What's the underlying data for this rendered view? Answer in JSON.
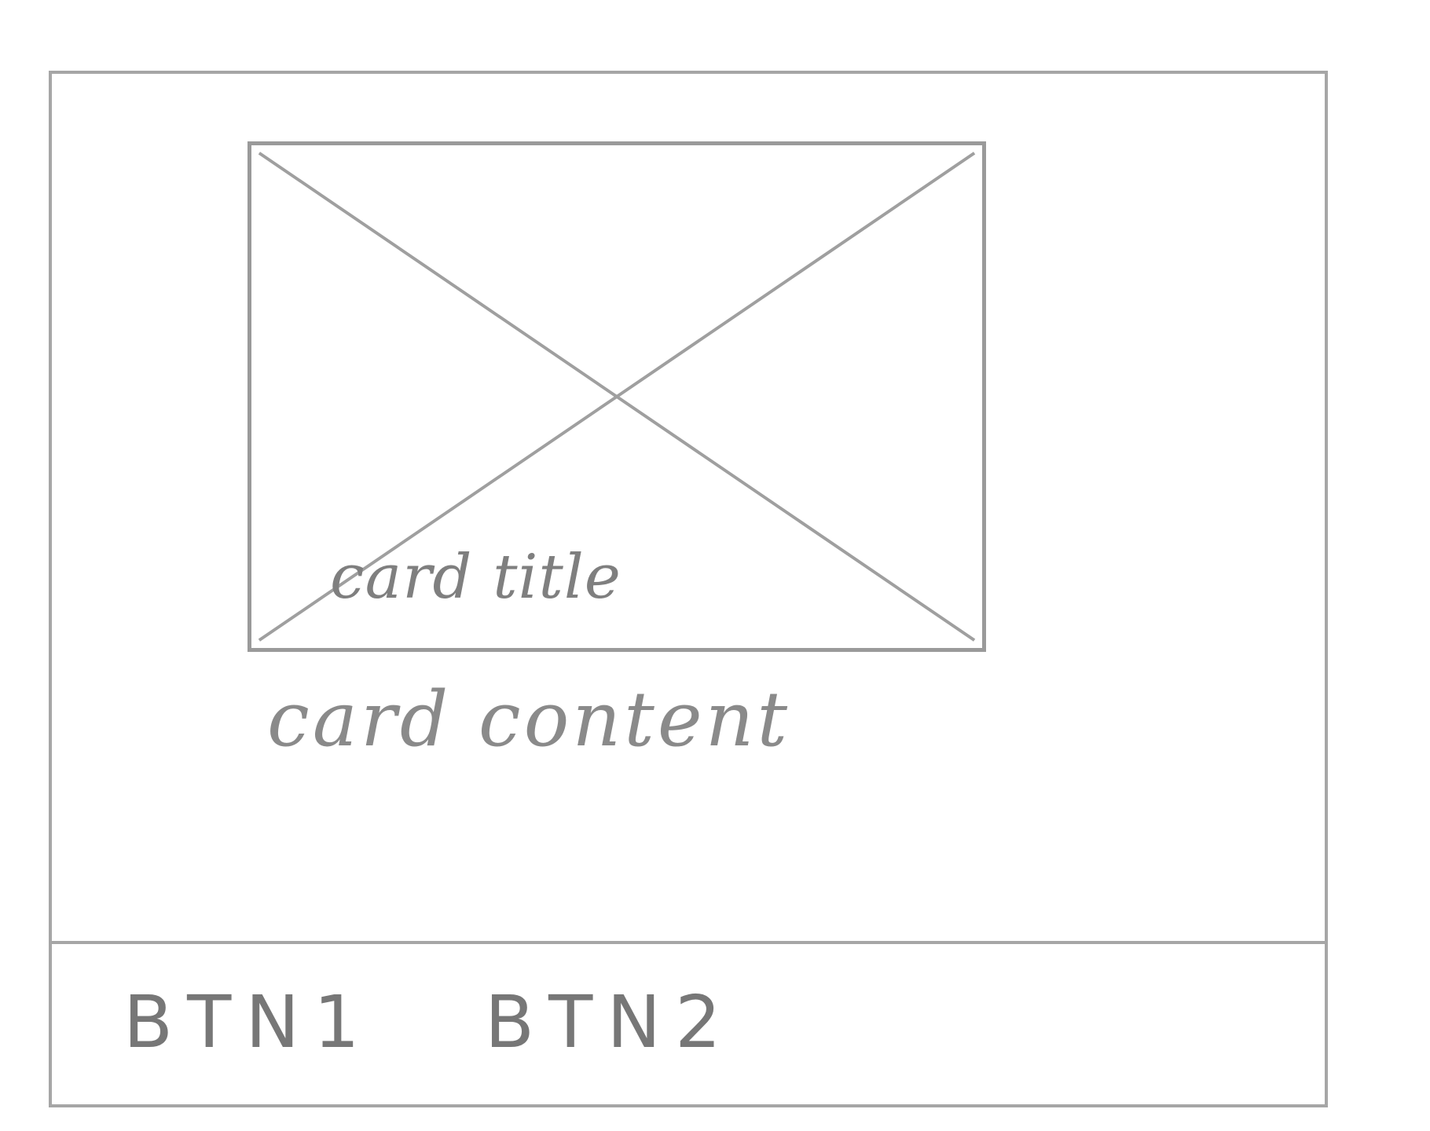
{
  "card": {
    "media_icon": "image-placeholder-icon",
    "title": "card title",
    "content": "card content"
  },
  "actions": {
    "btn1_label": "BTN1",
    "btn2_label": "BTN2"
  },
  "colors": {
    "sketch_line": "#a6a6a6",
    "sketch_text": "#7f7f7f",
    "background": "#ffffff"
  }
}
